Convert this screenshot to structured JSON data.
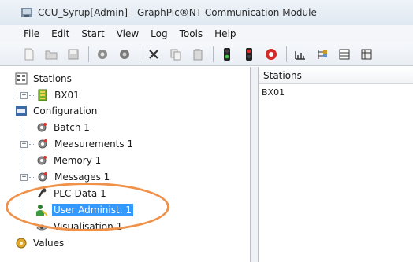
{
  "window": {
    "title": "CCU_Syrup[Admin] - GraphPic®NT Communication Module"
  },
  "menu": [
    "File",
    "Edit",
    "Start",
    "View",
    "Log",
    "Tools",
    "Help"
  ],
  "toolbar": {
    "icons": [
      "new-file-icon",
      "open-folder-icon",
      "save-icon",
      "connect-icon",
      "disconnect-icon",
      "delete-icon",
      "copy-icon",
      "paste-icon",
      "signal-green-icon",
      "signal-red-icon",
      "stop-icon",
      "chart-icon",
      "tree-icon",
      "grid-icon",
      "table-icon"
    ]
  },
  "tree": {
    "stations": "Stations",
    "bx01": "BX01",
    "configuration": "Configuration",
    "batch": "Batch 1",
    "measurements": "Measurements 1",
    "memory": "Memory 1",
    "messages": "Messages 1",
    "plc_data": "PLC-Data 1",
    "user_admin": "User Administ. 1",
    "visualisation": "Visualisation 1",
    "values": "Values"
  },
  "list": {
    "header": "Stations",
    "rows": [
      "BX01"
    ]
  },
  "colors": {
    "selection": "#3399ff",
    "highlight_ring": "#f0914a"
  }
}
